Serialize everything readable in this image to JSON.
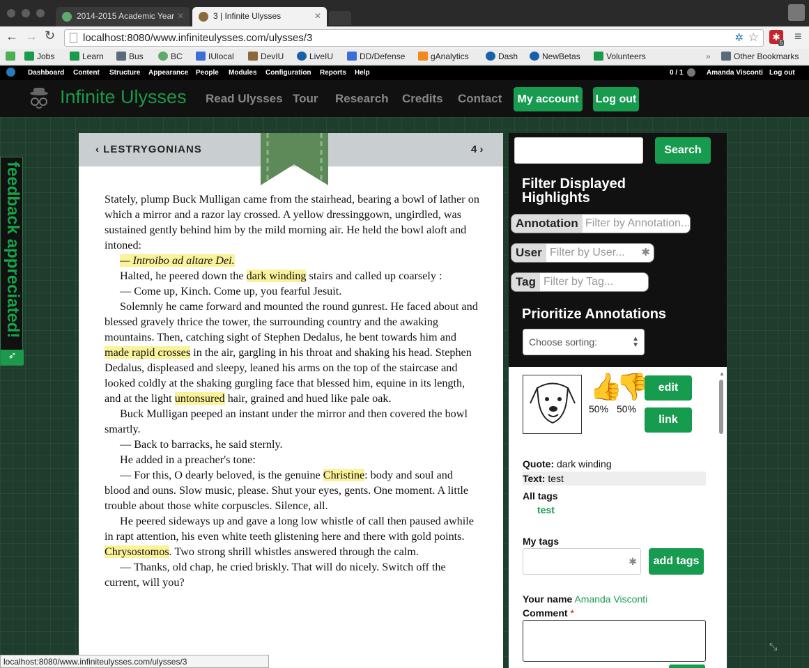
{
  "browser": {
    "tabs": [
      {
        "title": "2014-2015 Academic Year",
        "active": false
      },
      {
        "title": "3 | Infinite Ulysses",
        "active": true
      }
    ],
    "url": "localhost:8080/www.infiniteulysses.com/ulysses/3",
    "bookmarks": [
      "Jobs",
      "Learn",
      "Bus",
      "BC",
      "IUlocal",
      "DevIU",
      "LiveIU",
      "DD/Defense",
      "gAnalytics",
      "Dash",
      "NewBetas",
      "Volunteers"
    ],
    "other_bookmarks": "Other Bookmarks",
    "status_url": "localhost:8080/www.infiniteulysses.com/ulysses/3",
    "extension_badge": "5"
  },
  "admin_bar": {
    "items": [
      "Dashboard",
      "Content",
      "Structure",
      "Appearance",
      "People",
      "Modules",
      "Configuration",
      "Reports",
      "Help"
    ],
    "counter": "0 / 1",
    "user": "Amanda Visconti",
    "logout": "Log out"
  },
  "site": {
    "name": "Infinite Ulysses",
    "menu": [
      "Read Ulysses",
      "Tour",
      "Research",
      "Credits",
      "Contact"
    ],
    "my_account": "My account",
    "log_out": "Log out"
  },
  "feedback": {
    "label": "feedback appreciated!"
  },
  "chapter": {
    "prev": "‹ LESTRYGONIANS",
    "next": "4 ›",
    "text": {
      "p1": "Stately, plump Buck Mulligan came from the stairhead, bearing a bowl of lather on which a mirror and a razor lay crossed. A yellow dressinggown, ungirdled, was sustained gently behind him by the mild morning air. He held the bowl aloft and intoned:",
      "p2": "— Introibo ad altare Dei.",
      "p3a": "Halted, he peered down the ",
      "p3h": "dark winding",
      "p3b": " stairs and called up coarsely :",
      "p4": "— Come up, Kinch. Come up, you fearful Jesuit.",
      "p5a": "Solemnly he came forward and mounted the round gunrest. He faced about and blessed gravely thrice the tower, the surrounding country and the awaking mountains. Then, catching sight of Stephen Dedalus, he bent towards him and ",
      "p5h": "made rapid crosses",
      "p5b": " in the air, gargling in his throat and shaking his head. Stephen Dedalus, displeased and sleepy, leaned his arms on the top of the staircase and looked coldly at the shaking gurgling face that blessed him, equine in its length, and at the light ",
      "p5h2": "untonsured",
      "p5c": " hair, grained and hued like pale oak.",
      "p6": "Buck Mulligan peeped an instant under the mirror and then covered the bowl smartly.",
      "p7": "— Back to barracks, he said sternly.",
      "p8": "He added in a preacher's tone:",
      "p9a": "— For this, O dearly beloved, is the genuine ",
      "p9h": "Christine",
      "p9b": ": body and soul and blood and ouns. Slow music, please. Shut your eyes, gents. One moment. A little trouble about those white corpuscles. Silence, all.",
      "p10a": "He peered sideways up and gave a long low whistle of call then paused awhile in rapt attention, his even white teeth glistening here and there with gold points. ",
      "p10h": "Chrysostomos",
      "p10b": ". Two strong shrill whistles answered through the calm.",
      "p11": "— Thanks, old chap, he cried briskly. That will do nicely. Switch off the current, will you?"
    }
  },
  "sidebar": {
    "search_button": "Search",
    "filter_title": "Filter Displayed Highlights",
    "filters": [
      {
        "label": "Annotation",
        "placeholder": "Filter by Annotation..."
      },
      {
        "label": "User",
        "placeholder": "Filter by User..."
      },
      {
        "label": "Tag",
        "placeholder": "Filter by Tag..."
      }
    ],
    "prioritize_title": "Prioritize Annotations",
    "sort_placeholder": "Choose sorting:"
  },
  "annotation": {
    "up_pct": "50%",
    "down_pct": "50%",
    "edit": "edit",
    "link": "link",
    "quote_label": "Quote:",
    "quote": "dark winding",
    "text_label": "Text:",
    "text": "test",
    "all_tags_label": "All tags",
    "tags": [
      "test"
    ],
    "my_tags_label": "My tags",
    "add_tags": "add tags",
    "your_name_label": "Your name",
    "your_name": "Amanda Visconti",
    "comment_label": "Comment",
    "required": "*"
  },
  "colors": {
    "brand_green": "#169b4f",
    "highlight": "#fbf39a"
  }
}
